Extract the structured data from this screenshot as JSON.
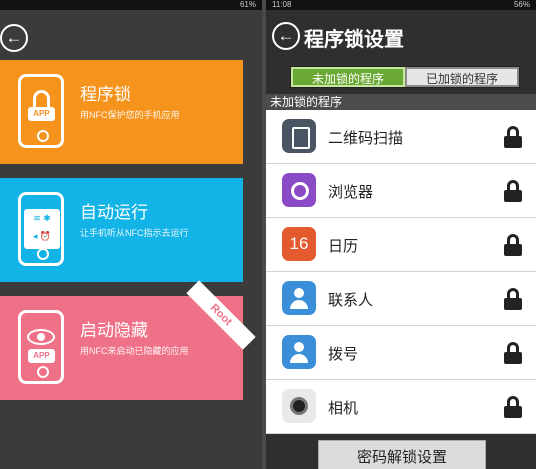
{
  "left": {
    "statusbar": {
      "battery": "61%"
    },
    "cards": [
      {
        "title": "程序锁",
        "desc": "用NFC保护您的手机应用",
        "badge": "APP"
      },
      {
        "title": "自动运行",
        "desc": "让手机听从NFC指示去运行"
      },
      {
        "title": "启动隐藏",
        "desc": "用NFC来启动已隐藏的应用",
        "badge": "APP",
        "ribbon": "Root"
      }
    ]
  },
  "right": {
    "statusbar": {
      "time": "11:08",
      "battery": "56%"
    },
    "title": "程序锁设置",
    "tabs": [
      {
        "label": "未加锁的程序"
      },
      {
        "label": "已加锁的程序"
      }
    ],
    "section_header": "未加锁的程序",
    "apps": [
      {
        "name": "二维码扫描",
        "icon": "qr-scanner-icon"
      },
      {
        "name": "浏览器",
        "icon": "browser-icon"
      },
      {
        "name": "日历",
        "icon": "calendar-icon",
        "icon_text": "16"
      },
      {
        "name": "联系人",
        "icon": "contacts-icon"
      },
      {
        "name": "拨号",
        "icon": "dialer-icon"
      },
      {
        "name": "相机",
        "icon": "camera-icon"
      }
    ],
    "password_button": "密码解锁设置"
  },
  "colors": {
    "orange": "#f5931d",
    "blue": "#12b3e6",
    "pink": "#ef7187",
    "green_tab": "#6aa834"
  }
}
